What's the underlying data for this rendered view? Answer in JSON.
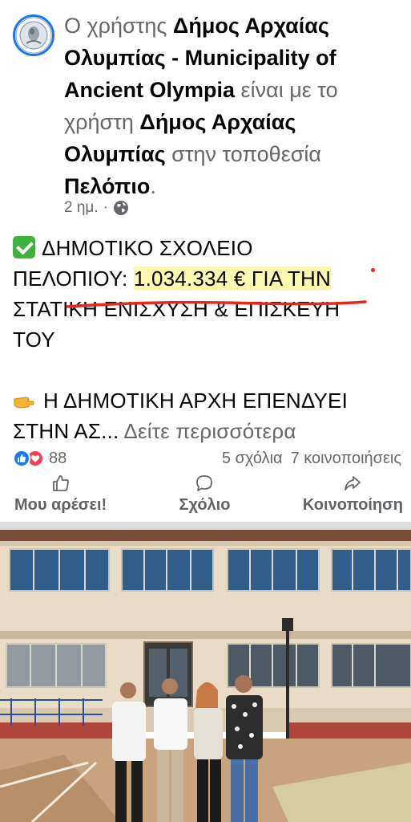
{
  "header": {
    "prefix": "Ο χρήστης ",
    "page_name": "Δήμος Αρχαίας Ολυμπίας - Municipality of Ancient Olympia",
    "with_text": " είναι με το χρήστη ",
    "tagged": "Δήμος Αρχαίας Ολυμπίας",
    "location_text": " στην τοποθεσία ",
    "location": "Πελόπιο",
    "period": ".",
    "time": "2 ημ.",
    "separator": "·",
    "privacy_icon": "globe-icon"
  },
  "post": {
    "line1": "ΔΗΜΟΤΙΚΟ ΣΧΟΛΕΙΟ",
    "line2a": "ΠΕΛΟΠΙΟΥ: ",
    "line2b": "1.034.334 € ΓΙΑ ΤΗΝ",
    "line3": "ΣΤΑΤΙΚΗ ΕΝΙΣΧΥΣΗ & ΕΠΙΣΚΕΥΗ",
    "line4": "ΤΟΥ",
    "line5": "Η ΔΗΜΟΤΙΚΗ ΑΡΧΗ ΕΠΕΝΔΥΕΙ",
    "line6": "ΣΤΗΝ ΑΣ...",
    "see_more": "Δείτε περισσότερα",
    "check_icon": "check-mark-emoji",
    "point_icon": "pointing-hand-emoji"
  },
  "stats": {
    "reaction_count": "88",
    "comments": "5 σχόλια",
    "shares": "7 κοινοποιήσεις"
  },
  "actions": {
    "like": "Μου αρέσει!",
    "comment": "Σχόλιο",
    "share": "Κοινοποίηση"
  },
  "colors": {
    "accent": "#1877f2",
    "love": "#f33e58",
    "highlight": "#faf596",
    "underline": "#e8281e"
  }
}
